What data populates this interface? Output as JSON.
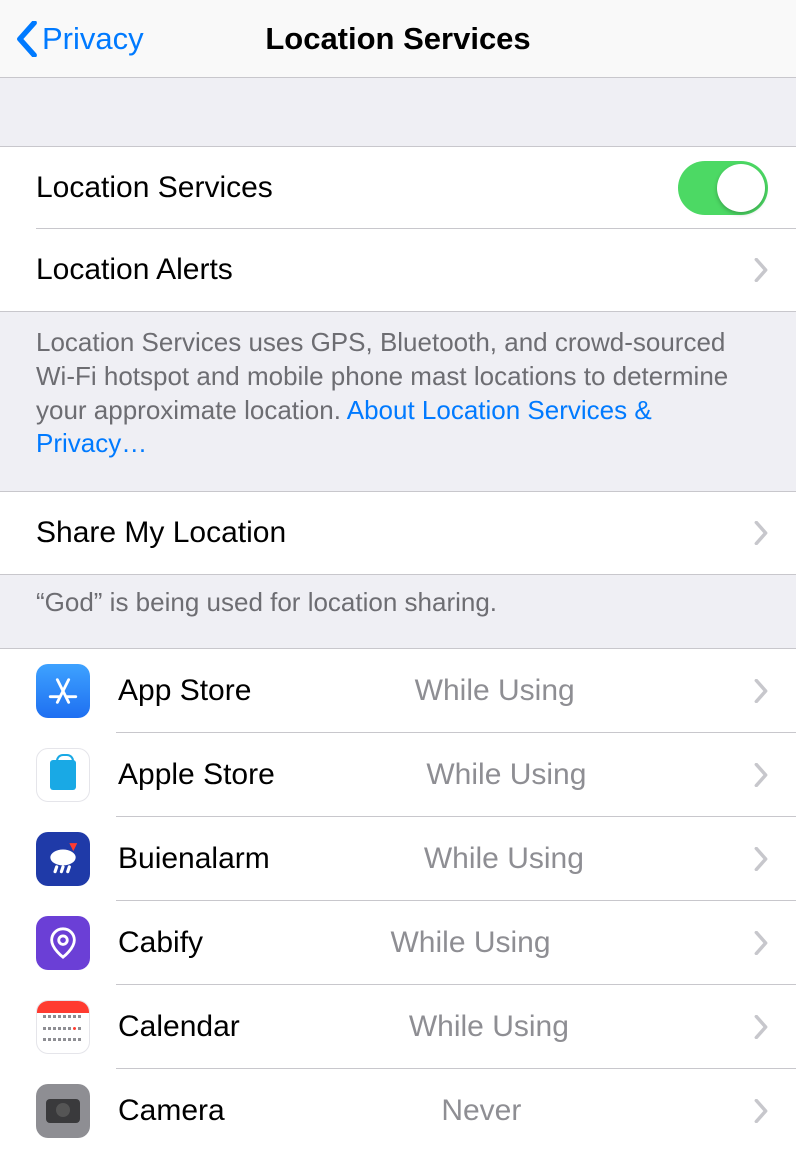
{
  "nav": {
    "back": "Privacy",
    "title": "Location Services"
  },
  "main": {
    "location_services_label": "Location Services",
    "location_alerts_label": "Location Alerts"
  },
  "footer1_text": "Location Services uses GPS, Bluetooth, and crowd-sourced Wi-Fi hotspot and mobile phone mast locations to determine your approximate location. ",
  "footer1_link": "About Location Services & Privacy…",
  "share": {
    "label": "Share My Location"
  },
  "footer2": "“God” is being used for location sharing.",
  "apps": [
    {
      "name": "App Store",
      "value": "While Using",
      "icon": "appstore"
    },
    {
      "name": "Apple Store",
      "value": "While Using",
      "icon": "applestore"
    },
    {
      "name": "Buienalarm",
      "value": "While Using",
      "icon": "buien"
    },
    {
      "name": "Cabify",
      "value": "While Using",
      "icon": "cabify"
    },
    {
      "name": "Calendar",
      "value": "While Using",
      "icon": "calendar"
    },
    {
      "name": "Camera",
      "value": "Never",
      "icon": "camera"
    }
  ]
}
